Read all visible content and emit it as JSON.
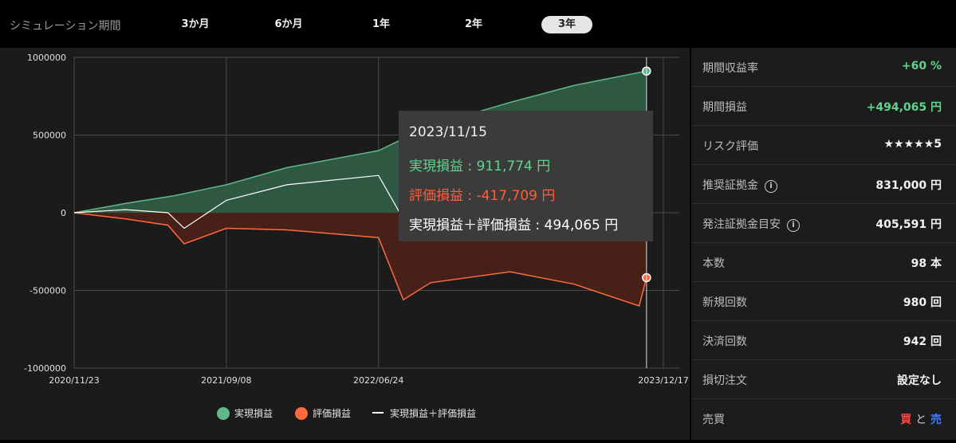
{
  "topbar": {
    "label": "シミュレーション期間",
    "tabs": [
      {
        "label": "3か月",
        "active": false
      },
      {
        "label": "6か月",
        "active": false
      },
      {
        "label": "1年",
        "active": false
      },
      {
        "label": "2年",
        "active": false
      },
      {
        "label": "3年",
        "active": true
      }
    ]
  },
  "chart_data": {
    "type": "area",
    "xlabels": [
      "2020/11/23",
      "2021/09/08",
      "2022/06/24",
      "2023/12/17"
    ],
    "ylim": [
      -1000000,
      1000000
    ],
    "yticks": [
      "1000000",
      "500000",
      "0",
      "-500000",
      "-1000000"
    ],
    "grid": true,
    "legend_position": "bottom",
    "series": [
      {
        "name": "実現損益",
        "color": "#5fb889",
        "x": [
          "2020/11/23",
          "2021/03/01",
          "2021/06/01",
          "2021/09/08",
          "2022/01/01",
          "2022/06/24",
          "2022/10/01",
          "2023/03/01",
          "2023/07/01",
          "2023/11/15"
        ],
        "values": [
          0,
          60000,
          110000,
          180000,
          290000,
          400000,
          560000,
          710000,
          820000,
          911774
        ]
      },
      {
        "name": "評価損益",
        "color": "#ff6a3c",
        "x": [
          "2020/11/23",
          "2021/03/01",
          "2021/05/20",
          "2021/06/20",
          "2021/09/08",
          "2022/01/01",
          "2022/06/24",
          "2022/08/10",
          "2022/10/01",
          "2023/03/01",
          "2023/07/01",
          "2023/11/01",
          "2023/11/15"
        ],
        "values": [
          0,
          -40000,
          -80000,
          -200000,
          -100000,
          -110000,
          -160000,
          -560000,
          -450000,
          -380000,
          -460000,
          -600000,
          -417709
        ]
      },
      {
        "name": "実現損益＋評価損益",
        "color": "#ffffff",
        "x": [
          "2020/11/23",
          "2021/03/01",
          "2021/05/20",
          "2021/06/20",
          "2021/09/08",
          "2022/01/01",
          "2022/06/24",
          "2022/08/10",
          "2022/10/01",
          "2023/03/01",
          "2023/07/01",
          "2023/11/01",
          "2023/11/15"
        ],
        "values": [
          0,
          20000,
          0,
          -100000,
          80000,
          180000,
          240000,
          -40000,
          110000,
          330000,
          360000,
          230000,
          494065
        ]
      }
    ],
    "tooltip": {
      "date": "2023/11/15",
      "realized": "実現損益 : 911,774 円",
      "unrealized": "評価損益 : -417,709 円",
      "total": "実現損益＋評価損益 : 494,065 円"
    }
  },
  "panel": {
    "rows": [
      {
        "key": "期間収益率",
        "value": "+60 %",
        "color": "green"
      },
      {
        "key": "期間損益",
        "value": "+494,065 円",
        "color": "green"
      },
      {
        "key": "リスク評価",
        "value": "★★★★★5",
        "color": "star"
      },
      {
        "key": "推奨証拠金",
        "value": "831,000 円",
        "info": true
      },
      {
        "key": "発注証拠金目安",
        "value": "405,591 円",
        "info": true
      },
      {
        "key": "本数",
        "value": "98 本"
      },
      {
        "key": "新規回数",
        "value": "980 回"
      },
      {
        "key": "決済回数",
        "value": "942 回"
      },
      {
        "key": "損切注文",
        "value": "設定なし"
      },
      {
        "key": "売買",
        "value_buy": "買",
        "value_and": "と",
        "value_sell": "売"
      }
    ]
  },
  "colors": {
    "realized": "#5fb889",
    "unrealized": "#ff6a3c",
    "total": "#ffffff",
    "buy": "#ff4444",
    "sell": "#3d7bff"
  }
}
